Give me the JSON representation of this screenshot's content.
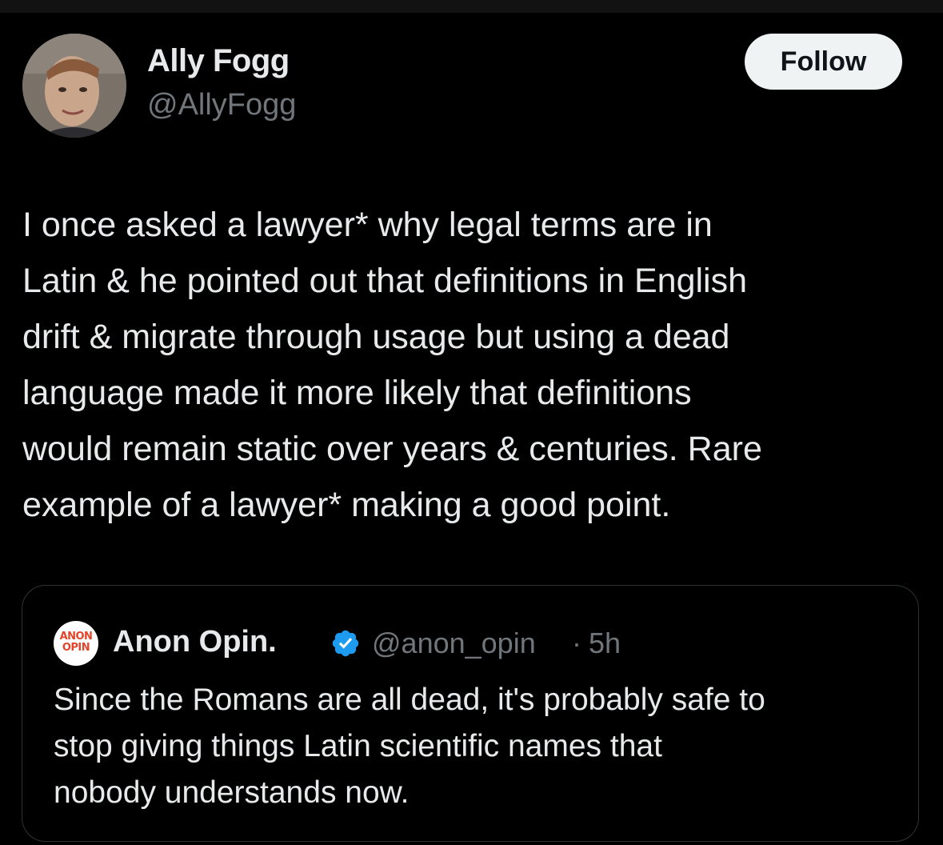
{
  "theme": {
    "background": "#000000",
    "text_primary": "#e7e9ea",
    "text_secondary": "#71767b",
    "follow_button_bg": "#eff3f4",
    "verified_blue": "#1d9bf0",
    "quote_border": "#2f3336"
  },
  "post": {
    "author": {
      "name": "Ally Fogg",
      "handle": "@AllyFogg",
      "avatar_icon": "profile-photo"
    },
    "follow_label": "Follow",
    "text": "I once asked a lawyer* why legal terms are in\nLatin & he pointed out that definitions in English\ndrift & migrate through usage but using a dead\nlanguage made it more likely that definitions\nwould remain static over years & centuries. Rare\nexample of a lawyer* making a good point."
  },
  "quoted_post": {
    "avatar_line1": "ANON",
    "avatar_line2": "OPIN",
    "name": "Anon Opin.",
    "verified_icon": "verified-badge-icon",
    "handle": "@anon_opin",
    "separator": "·",
    "time": "5h",
    "text": "Since the Romans are all dead, it's probably safe to\nstop giving things Latin scientific names that\nnobody understands now."
  }
}
